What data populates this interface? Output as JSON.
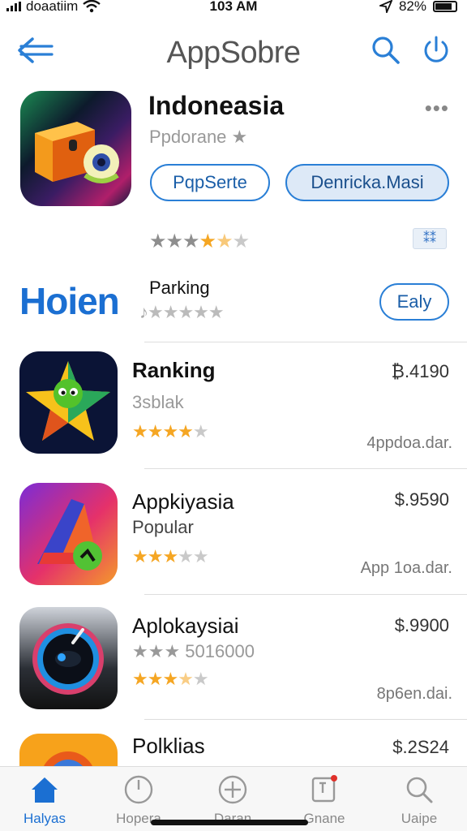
{
  "status": {
    "carrier": "doaatiim",
    "time": "103 AM",
    "battery": "82%"
  },
  "header": {
    "title": "AppSobre"
  },
  "app": {
    "name": "Indoneasia",
    "subtitle": "Ppdorane ★",
    "primary_button": "PqpSerte",
    "secondary_button": "Denricka.Masi",
    "rating_stars": "★★★★★",
    "badge": "⁑⁑"
  },
  "feature": {
    "logo": "Hoien",
    "label": "Parking",
    "rating_stars": "★★★★★",
    "button": "Ealy"
  },
  "list": [
    {
      "name": "Ranking",
      "subtitle": "3sblak",
      "price": "₿.4190",
      "stars": "★★★★★",
      "rating": 4,
      "meta": "4ppdoa.dar."
    },
    {
      "name": "Appkiyasia",
      "subtitle": "Popular",
      "price": "$.9590",
      "stars": "★★★★★",
      "rating": 3,
      "meta": "App 1oa.dar."
    },
    {
      "name": "Aplokaysiai",
      "subtitle": "★★★ 5016000",
      "price": "$.9900",
      "stars": "★★★★★",
      "rating": 3.5,
      "meta": "8p6en.dai."
    },
    {
      "name": "Polklias",
      "subtitle": "",
      "price": "$.2S24",
      "stars": "",
      "rating": 0,
      "meta": ""
    }
  ],
  "tabs": [
    {
      "label": "Halyas",
      "icon": "home-icon",
      "active": true
    },
    {
      "label": "Hopera",
      "icon": "clock-icon",
      "active": false
    },
    {
      "label": "Daran",
      "icon": "plus-circle-icon",
      "active": false
    },
    {
      "label": "Gnane",
      "icon": "notification-icon",
      "active": false
    },
    {
      "label": "Uaipe",
      "icon": "search-icon",
      "active": false
    }
  ],
  "colors": {
    "accent": "#1b6fd2",
    "star": "#f5a623",
    "button_border": "#2a7fd6"
  }
}
